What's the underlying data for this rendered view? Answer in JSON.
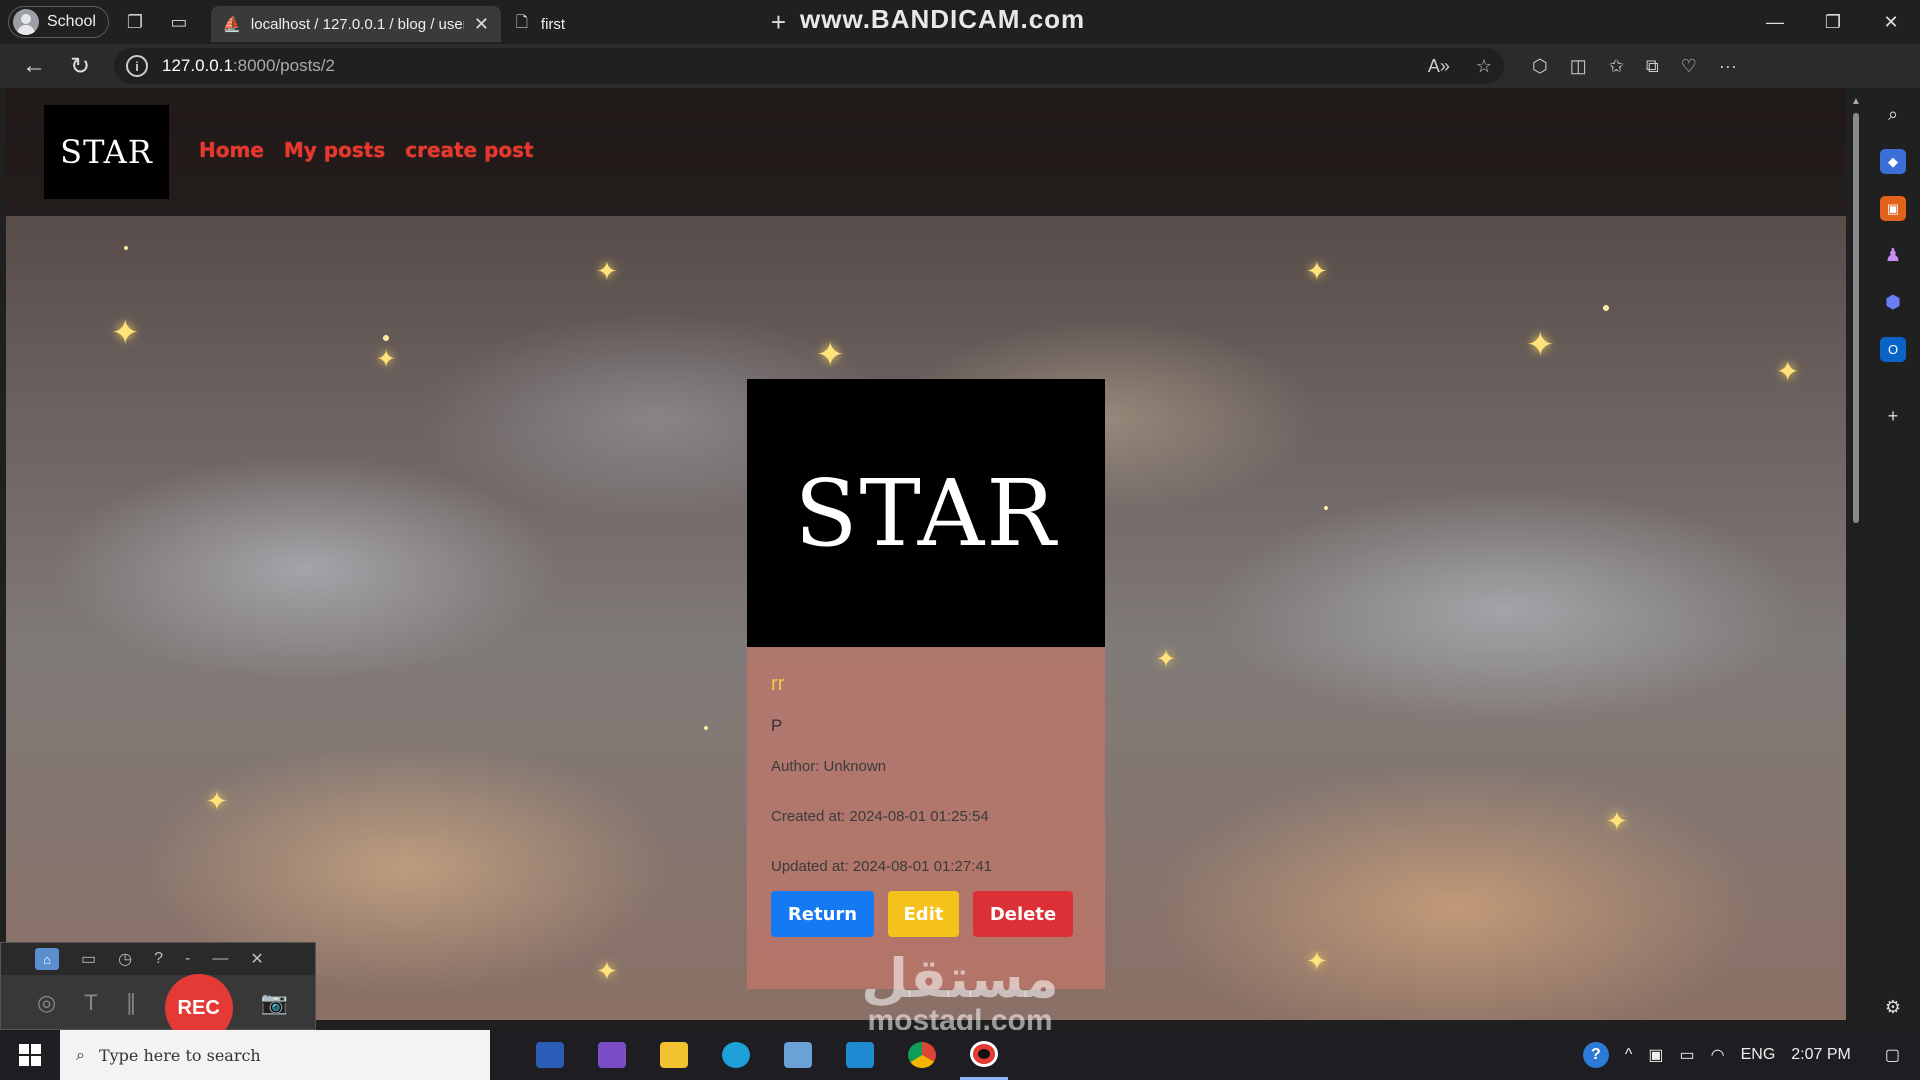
{
  "browser": {
    "profile_label": "School",
    "tabs": [
      {
        "title": "localhost / 127.0.0.1 / blog / user"
      },
      {
        "title": "first"
      }
    ],
    "url_host": "127.0.0.1",
    "url_path": ":8000/posts/2",
    "watermark": "www.BANDICAM.com"
  },
  "site": {
    "logo_text": "STAR",
    "nav": {
      "home": "Home",
      "my_posts": "My posts",
      "create_post": "create post"
    }
  },
  "post": {
    "image_text": "STAR",
    "title": "rr",
    "body": "P",
    "author": "Author: Unknown",
    "created": "Created at: 2024-08-01 01:25:54",
    "updated": "Updated at: 2024-08-01 01:27:41",
    "buttons": {
      "return": "Return",
      "edit": "Edit",
      "delete": "Delete"
    }
  },
  "recorder": {
    "rec_label": "REC"
  },
  "overlay_watermark": {
    "arabic": "مستقل",
    "latin": "mostaql.com"
  },
  "taskbar": {
    "search_placeholder": "Type here to search",
    "language": "ENG",
    "time": "2:07 PM"
  },
  "colors": {
    "nav_link": "#e5392f",
    "return": "#1479f2",
    "edit": "#f4c21a",
    "delete": "#dc3037",
    "post_title": "#f2c94c"
  }
}
